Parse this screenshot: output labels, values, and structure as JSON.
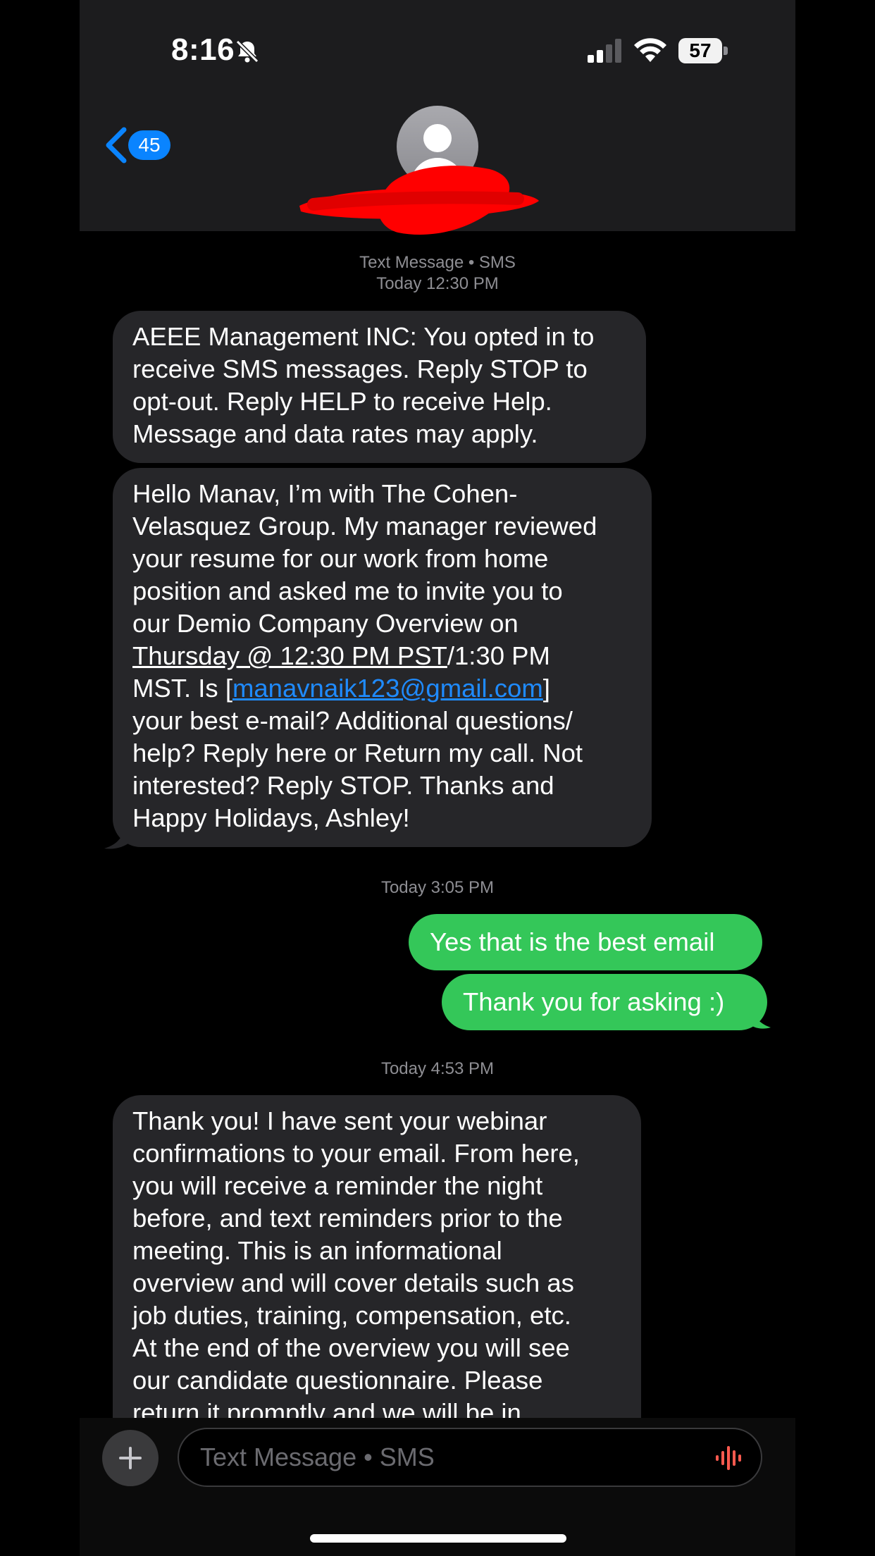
{
  "status_bar": {
    "time": "8:16",
    "battery": "57",
    "icons": [
      "bell-slash-icon",
      "cellular-signal-icon",
      "wifi-icon",
      "battery-icon"
    ]
  },
  "header": {
    "back_badge": "45",
    "icons": [
      "back-chevron-icon",
      "contact-avatar-icon"
    ]
  },
  "thread": {
    "service_label": "Text Message • SMS",
    "groups": [
      {
        "timestamp": "Today 12:30 PM"
      },
      {
        "timestamp": "Today 3:05 PM"
      },
      {
        "timestamp": "Today 4:53 PM"
      }
    ],
    "messages": [
      {
        "direction": "incoming",
        "lines": [
          "AEEE Management INC: You opted in to",
          "receive SMS messages. Reply STOP to",
          "opt-out. Reply HELP to receive Help.",
          "Message and data rates may apply."
        ]
      },
      {
        "direction": "incoming",
        "lines": [
          "Hello Manav, I’m with The Cohen-",
          "Velasquez Group. My manager reviewed",
          "your resume for our work from home",
          "position and asked me to invite you to",
          "our Demio Company Overview on"
        ],
        "date_link": "Thursday @ 12:30 PM PST",
        "date_after": "/1:30 PM",
        "email_before": "MST. Is [",
        "email_link": "manavnaik123@gmail.com",
        "email_after": "]",
        "lines_after": [
          "your best e-mail? Additional questions/",
          "help? Reply here or Return my call. Not",
          "interested? Reply STOP. Thanks and",
          "Happy Holidays, Ashley!"
        ]
      },
      {
        "direction": "outgoing",
        "text": "Yes that is the best email"
      },
      {
        "direction": "outgoing",
        "text": "Thank you for asking :)"
      },
      {
        "direction": "incoming",
        "lines": [
          "Thank you! I have sent your webinar",
          "confirmations to your email. From here,",
          "you will receive a reminder the night",
          "before, and text reminders prior to the",
          "meeting. This is an informational",
          "overview and will cover details such as",
          "job duties, training, compensation, etc.",
          "At the end of the overview you will see",
          "our candidate questionnaire. Please",
          "return it promptly and we will be in"
        ]
      }
    ]
  },
  "input_bar": {
    "placeholder": "Text Message • SMS",
    "icons": [
      "plus-icon",
      "audio-waveform-icon"
    ]
  }
}
